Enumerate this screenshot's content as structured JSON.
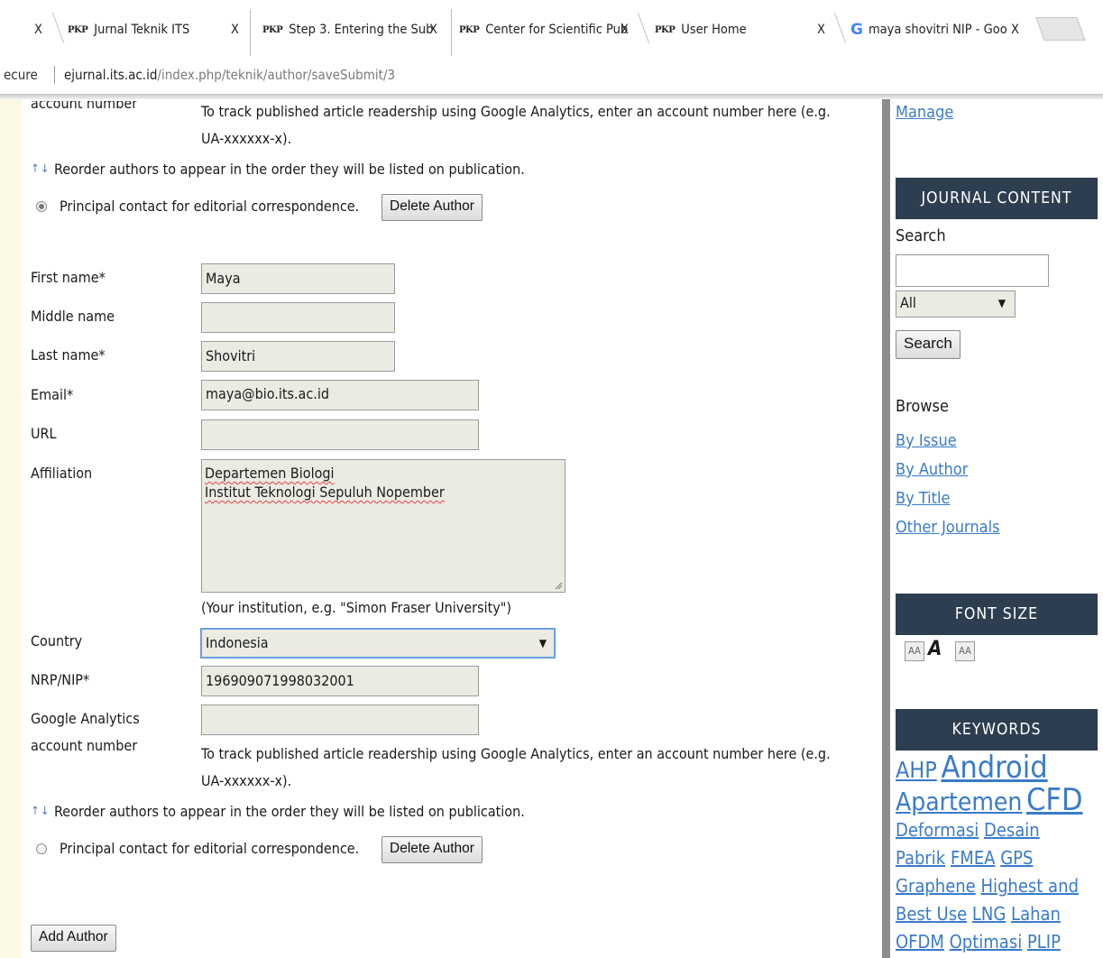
{
  "tabs": [
    {
      "favicon": "PKP",
      "title": "Jurnal Teknik ITS"
    },
    {
      "favicon": "PKP",
      "title": "Step 3. Entering the Sub"
    },
    {
      "favicon": "PKP",
      "title": "Center for Scientific Pub"
    },
    {
      "favicon": "PKP",
      "title": "User Home"
    },
    {
      "favicon": "google-icon",
      "title": "maya shovitri NIP - Goo"
    }
  ],
  "tab_close_glyph": "X",
  "address": {
    "secure": "ecure",
    "host": "ejurnal.its.ac.id",
    "path": "/index.php/teknik/author/saveSubmit/3"
  },
  "author1": {
    "ga_label": "account number",
    "ga_help_1": "To track published article readership using Google Analytics, enter an account number here (e.g.",
    "ga_help_2": "UA-xxxxxx-x).",
    "reorder": "Reorder authors to appear in the order they will be listed on publication.",
    "principal": "Principal contact for editorial correspondence.",
    "principal_selected": true,
    "delete": "Delete Author"
  },
  "author2": {
    "first_name_label": "First name*",
    "first_name": "Maya",
    "middle_name_label": "Middle name",
    "middle_name": "",
    "last_name_label": "Last name*",
    "last_name": "Shovitri",
    "email_label": "Email*",
    "email": "maya@bio.its.ac.id",
    "url_label": "URL",
    "url": "",
    "affiliation_label": "Affiliation",
    "affiliation_line1": "Departemen Biologi",
    "affiliation_line2": "Institut Teknologi Sepuluh Nopember",
    "affiliation_help": "(Your institution, e.g. \"Simon Fraser University\")",
    "country_label": "Country",
    "country": "Indonesia",
    "nip_label": "NRP/NIP*",
    "nip": "196909071998032001",
    "ga_label_1": "Google Analytics",
    "ga_label_2": "account number",
    "ga": "",
    "ga_help_1": "To track published article readership using Google Analytics, enter an account number here (e.g.",
    "ga_help_2": "UA-xxxxxx-x).",
    "reorder": "Reorder authors to appear in the order they will be listed on publication.",
    "principal": "Principal contact for editorial correspondence.",
    "principal_selected": false,
    "delete": "Delete Author"
  },
  "add_author": "Add Author",
  "sidebar": {
    "manage": "Manage",
    "journal_content": "JOURNAL CONTENT",
    "search_label": "Search",
    "search_value": "",
    "scope": "All",
    "search_button": "Search",
    "browse": "Browse",
    "browse_links": [
      "By Issue",
      "By Author",
      "By Title",
      "Other Journals"
    ],
    "font_size": "FONT SIZE",
    "font_icons": [
      "decrease-font-icon",
      "default-font-icon",
      "increase-font-icon"
    ],
    "keywords_title": "KEYWORDS",
    "keywords": [
      "AHP",
      "Android",
      "Apartemen",
      "CFD",
      "Deformasi",
      "Desain",
      "Pabrik",
      "FMEA",
      "GPS",
      "Graphene",
      "Highest and",
      "Best Use",
      "LNG",
      "Lahan",
      "OFDM",
      "Optimasi",
      "PLIP"
    ]
  },
  "colors": {
    "sidebar_block": "#2c3e50",
    "link": "#3a7bc8",
    "page_edge": "#fbf8e4",
    "field_bg": "#ecebe3"
  }
}
